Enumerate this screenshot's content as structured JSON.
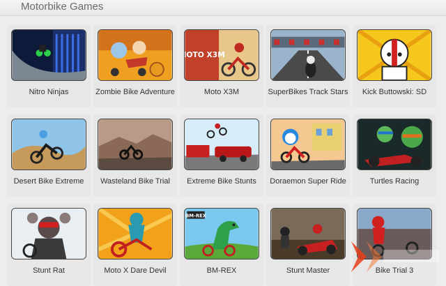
{
  "header": {
    "title": "Motorbike Games"
  },
  "games": [
    {
      "title": "Nitro Ninjas"
    },
    {
      "title": "Zombie Bike Adventure"
    },
    {
      "title": "Moto X3M"
    },
    {
      "title": "SuperBikes Track Stars"
    },
    {
      "title": "Kick Buttowski: SD"
    },
    {
      "title": "Desert Bike Extreme"
    },
    {
      "title": "Wasteland Bike Trial"
    },
    {
      "title": "Extreme Bike Stunts"
    },
    {
      "title": "Doraemon Super Ride"
    },
    {
      "title": "Turtles Racing"
    },
    {
      "title": "Stunt Rat"
    },
    {
      "title": "Moto X Dare Devil"
    },
    {
      "title": "BM-REX"
    },
    {
      "title": "Stunt Master"
    },
    {
      "title": "Bike Trial 3"
    }
  ],
  "thumb_text": {
    "moto_x3m": "MOTO X3M",
    "bmrex": "BM-REX"
  },
  "colors": {
    "page_bg": "#ededed",
    "card_bg": "#e7e7e7",
    "title_text": "#333333",
    "header_text": "#6a6a6a"
  }
}
